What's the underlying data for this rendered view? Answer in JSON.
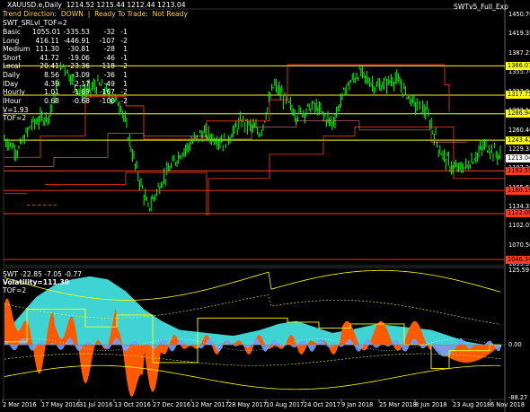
{
  "header": {
    "symbol_line": "XAUUSD.e,Daily  1214.52 1215.44 1212.44 1213.04",
    "trend_direction": "Trend Direction:  DOWN  |  Ready To Trade:  Not Ready",
    "indicator_name": "SWTv5_Full_Exp"
  },
  "srlvl_label": "SWT_SRLvl_TOF=2",
  "table_rows": [
    {
      "name": "Basic",
      "a": "1055.01",
      "b": "-335.53",
      "c": "-32",
      "d": "-1"
    },
    {
      "name": "Long",
      "a": "416.11",
      "b": "-446.91",
      "c": "-107",
      "d": "-2"
    },
    {
      "name": "Medium",
      "a": "111.30",
      "b": "-30.81",
      "c": "-28",
      "d": "1"
    },
    {
      "name": "Short",
      "a": "41.72",
      "b": "-19.06",
      "c": "-46",
      "d": "-1"
    },
    {
      "name": "Local",
      "a": "20.41",
      "b": "-23.36",
      "c": "-118",
      "d": "-2"
    },
    {
      "name": "Daily",
      "a": "8.56",
      "b": "-3.09",
      "c": "-36",
      "d": "1"
    },
    {
      "name": "IDay",
      "a": "4.39",
      "b": "-2.17",
      "c": "-49",
      "d": "1"
    },
    {
      "name": "Hourly",
      "a": "1.01",
      "b": "-1.69",
      "c": "-167",
      "d": "-2"
    },
    {
      "name": "IHour",
      "a": "0.68",
      "b": "-0.68",
      "c": "-100",
      "d": "-2"
    }
  ],
  "v_label": "V=1.93",
  "tof_label": "TOF=2",
  "main_axis_labels": [
    "1450.70",
    "1419.35",
    "1387.25",
    "1355.70",
    "1323.90",
    "1292.15",
    "1260.40",
    "1229.35",
    "1197.30",
    "1165.65",
    "1134.35",
    "1102.05",
    "1070.50",
    "1039.35"
  ],
  "level_tags": [
    {
      "value": "1366.07",
      "color": "#ffff00"
    },
    {
      "value": "1317.75",
      "color": "#ffff00"
    },
    {
      "value": "1286.94",
      "color": "#ffff00"
    },
    {
      "value": "1243.42",
      "color": "#ffff00"
    },
    {
      "value": "1213.04",
      "color": "#ffffff"
    },
    {
      "value": "1192.59",
      "color": "#ff3b1f"
    },
    {
      "value": "1160.19",
      "color": "#ff3b1f"
    },
    {
      "value": "1122.00",
      "color": "#ff3b1f"
    },
    {
      "value": "1046.34",
      "color": "#ff3b1f"
    }
  ],
  "sub_header": {
    "line": "SWT -22.85 -7.05 -0.77",
    "volatility": "Volatility=111.30",
    "tof": "TOF=2"
  },
  "sub_axis_labels": [
    "125.59",
    "0.00",
    "-88.27"
  ],
  "x_labels": [
    "2 Mar 2016",
    "17 May 2016",
    "31 Jul 2016",
    "13 Oct 2016",
    "27 Dec 2016",
    "12 Mar 2017",
    "28 May 2017",
    "10 Aug 2017",
    "24 Oct 2017",
    "9 Jan 2018",
    "25 Mar 2018",
    "8 Jun 2018",
    "23 Aug 2018",
    "6 Nov 2018"
  ],
  "colors": {
    "price": "#00ff00",
    "support": "#ff3b1f",
    "resistance": "#ffff00",
    "cyan_fill": "#3fd3d3",
    "orange_fill": "#ff5a00",
    "blue_fill": "#6ea0ff"
  }
}
